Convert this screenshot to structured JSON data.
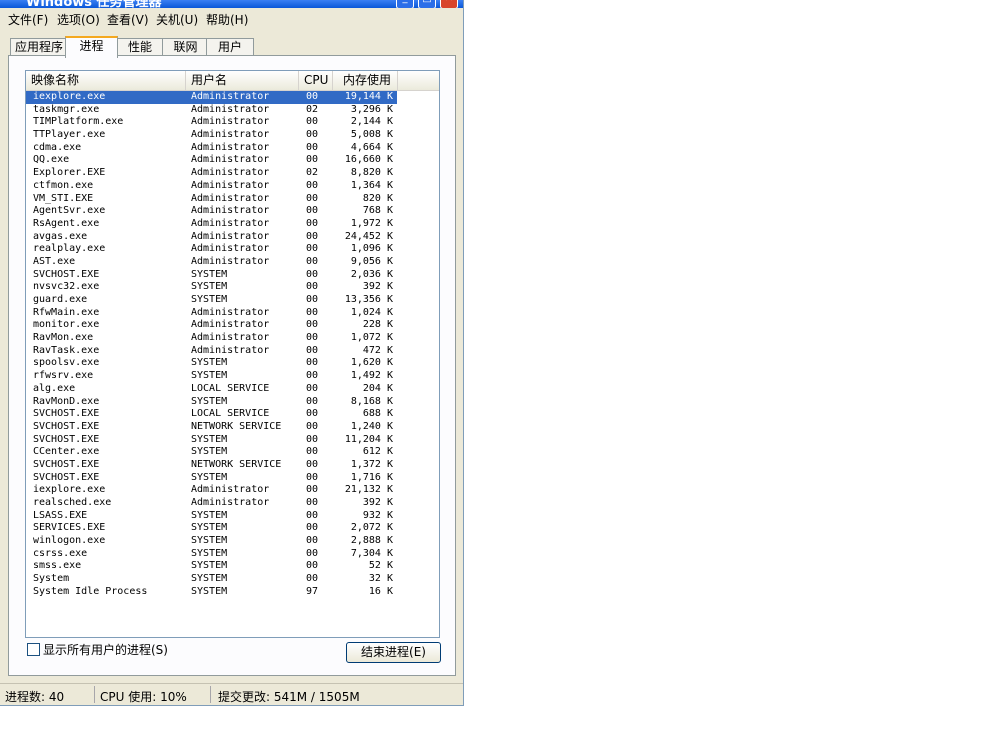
{
  "window": {
    "title": "Windows 任务管理器"
  },
  "menu": [
    "文件(F)",
    "选项(O)",
    "查看(V)",
    "关机(U)",
    "帮助(H)"
  ],
  "tabs": [
    "应用程序",
    "进程",
    "性能",
    "联网",
    "用户"
  ],
  "columns": {
    "name": "映像名称",
    "user": "用户名",
    "cpu": "CPU",
    "mem": "内存使用"
  },
  "processes": [
    {
      "name": "iexplore.exe",
      "user": "Administrator",
      "cpu": "00",
      "mem": "19,144 K"
    },
    {
      "name": "taskmgr.exe",
      "user": "Administrator",
      "cpu": "02",
      "mem": "3,296 K"
    },
    {
      "name": "TIMPlatform.exe",
      "user": "Administrator",
      "cpu": "00",
      "mem": "2,144 K"
    },
    {
      "name": "TTPlayer.exe",
      "user": "Administrator",
      "cpu": "00",
      "mem": "5,008 K"
    },
    {
      "name": "cdma.exe",
      "user": "Administrator",
      "cpu": "00",
      "mem": "4,664 K"
    },
    {
      "name": "QQ.exe",
      "user": "Administrator",
      "cpu": "00",
      "mem": "16,660 K"
    },
    {
      "name": "Explorer.EXE",
      "user": "Administrator",
      "cpu": "02",
      "mem": "8,820 K"
    },
    {
      "name": "ctfmon.exe",
      "user": "Administrator",
      "cpu": "00",
      "mem": "1,364 K"
    },
    {
      "name": "VM_STI.EXE",
      "user": "Administrator",
      "cpu": "00",
      "mem": "820 K"
    },
    {
      "name": "AgentSvr.exe",
      "user": "Administrator",
      "cpu": "00",
      "mem": "768 K"
    },
    {
      "name": "RsAgent.exe",
      "user": "Administrator",
      "cpu": "00",
      "mem": "1,972 K"
    },
    {
      "name": "avgas.exe",
      "user": "Administrator",
      "cpu": "00",
      "mem": "24,452 K"
    },
    {
      "name": "realplay.exe",
      "user": "Administrator",
      "cpu": "00",
      "mem": "1,096 K"
    },
    {
      "name": "AST.exe",
      "user": "Administrator",
      "cpu": "00",
      "mem": "9,056 K"
    },
    {
      "name": "SVCHOST.EXE",
      "user": "SYSTEM",
      "cpu": "00",
      "mem": "2,036 K"
    },
    {
      "name": "nvsvc32.exe",
      "user": "SYSTEM",
      "cpu": "00",
      "mem": "392 K"
    },
    {
      "name": "guard.exe",
      "user": "SYSTEM",
      "cpu": "00",
      "mem": "13,356 K"
    },
    {
      "name": "RfwMain.exe",
      "user": "Administrator",
      "cpu": "00",
      "mem": "1,024 K"
    },
    {
      "name": "monitor.exe",
      "user": "Administrator",
      "cpu": "00",
      "mem": "228 K"
    },
    {
      "name": "RavMon.exe",
      "user": "Administrator",
      "cpu": "00",
      "mem": "1,072 K"
    },
    {
      "name": "RavTask.exe",
      "user": "Administrator",
      "cpu": "00",
      "mem": "472 K"
    },
    {
      "name": "spoolsv.exe",
      "user": "SYSTEM",
      "cpu": "00",
      "mem": "1,620 K"
    },
    {
      "name": "rfwsrv.exe",
      "user": "SYSTEM",
      "cpu": "00",
      "mem": "1,492 K"
    },
    {
      "name": "alg.exe",
      "user": "LOCAL SERVICE",
      "cpu": "00",
      "mem": "204 K"
    },
    {
      "name": "RavMonD.exe",
      "user": "SYSTEM",
      "cpu": "00",
      "mem": "8,168 K"
    },
    {
      "name": "SVCHOST.EXE",
      "user": "LOCAL SERVICE",
      "cpu": "00",
      "mem": "688 K"
    },
    {
      "name": "SVCHOST.EXE",
      "user": "NETWORK SERVICE",
      "cpu": "00",
      "mem": "1,240 K"
    },
    {
      "name": "SVCHOST.EXE",
      "user": "SYSTEM",
      "cpu": "00",
      "mem": "11,204 K"
    },
    {
      "name": "CCenter.exe",
      "user": "SYSTEM",
      "cpu": "00",
      "mem": "612 K"
    },
    {
      "name": "SVCHOST.EXE",
      "user": "NETWORK SERVICE",
      "cpu": "00",
      "mem": "1,372 K"
    },
    {
      "name": "SVCHOST.EXE",
      "user": "SYSTEM",
      "cpu": "00",
      "mem": "1,716 K"
    },
    {
      "name": "iexplore.exe",
      "user": "Administrator",
      "cpu": "00",
      "mem": "21,132 K"
    },
    {
      "name": "realsched.exe",
      "user": "Administrator",
      "cpu": "00",
      "mem": "392 K"
    },
    {
      "name": "LSASS.EXE",
      "user": "SYSTEM",
      "cpu": "00",
      "mem": "932 K"
    },
    {
      "name": "SERVICES.EXE",
      "user": "SYSTEM",
      "cpu": "00",
      "mem": "2,072 K"
    },
    {
      "name": "winlogon.exe",
      "user": "SYSTEM",
      "cpu": "00",
      "mem": "2,888 K"
    },
    {
      "name": "csrss.exe",
      "user": "SYSTEM",
      "cpu": "00",
      "mem": "7,304 K"
    },
    {
      "name": "smss.exe",
      "user": "SYSTEM",
      "cpu": "00",
      "mem": "52 K"
    },
    {
      "name": "System",
      "user": "SYSTEM",
      "cpu": "00",
      "mem": "32 K"
    },
    {
      "name": "System Idle Process",
      "user": "SYSTEM",
      "cpu": "97",
      "mem": "16 K"
    }
  ],
  "show_all_users_label": "显示所有用户的进程(S)",
  "end_process_label": "结束进程(E)",
  "status": {
    "processes": "进程数: 40",
    "cpu": "CPU 使用: 10%",
    "commit": "提交更改: 541M / 1505M"
  }
}
